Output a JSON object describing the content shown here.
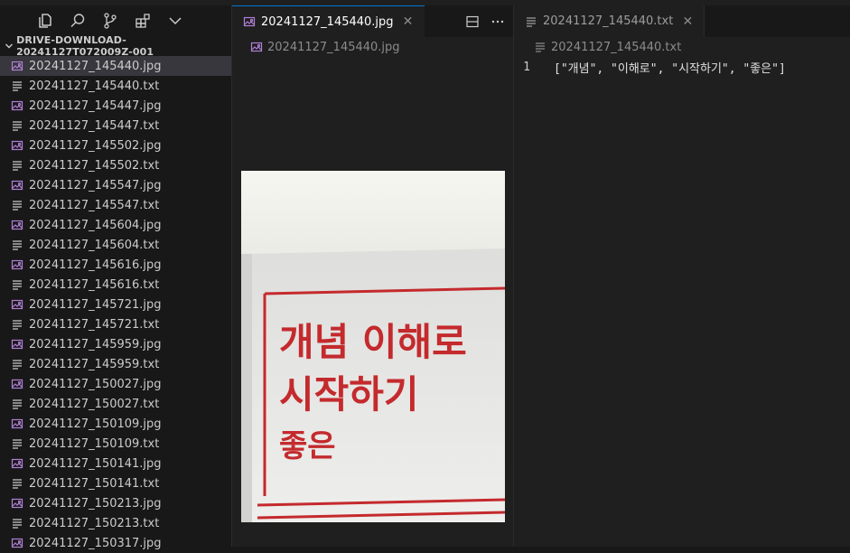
{
  "sidebar": {
    "activity_icons": [
      "explorer-icon",
      "search-icon",
      "source-control-icon",
      "extensions-icon",
      "more-views-chevron-icon"
    ],
    "folder_name": "DRIVE-DOWNLOAD-20241127T072009Z-001",
    "files": [
      {
        "name": "20241127_145440.jpg",
        "type": "image",
        "selected": true
      },
      {
        "name": "20241127_145440.txt",
        "type": "text"
      },
      {
        "name": "20241127_145447.jpg",
        "type": "image"
      },
      {
        "name": "20241127_145447.txt",
        "type": "text"
      },
      {
        "name": "20241127_145502.jpg",
        "type": "image"
      },
      {
        "name": "20241127_145502.txt",
        "type": "text"
      },
      {
        "name": "20241127_145547.jpg",
        "type": "image"
      },
      {
        "name": "20241127_145547.txt",
        "type": "text"
      },
      {
        "name": "20241127_145604.jpg",
        "type": "image"
      },
      {
        "name": "20241127_145604.txt",
        "type": "text"
      },
      {
        "name": "20241127_145616.jpg",
        "type": "image"
      },
      {
        "name": "20241127_145616.txt",
        "type": "text"
      },
      {
        "name": "20241127_145721.jpg",
        "type": "image"
      },
      {
        "name": "20241127_145721.txt",
        "type": "text"
      },
      {
        "name": "20241127_145959.jpg",
        "type": "image"
      },
      {
        "name": "20241127_145959.txt",
        "type": "text"
      },
      {
        "name": "20241127_150027.jpg",
        "type": "image"
      },
      {
        "name": "20241127_150027.txt",
        "type": "text"
      },
      {
        "name": "20241127_150109.jpg",
        "type": "image"
      },
      {
        "name": "20241127_150109.txt",
        "type": "text"
      },
      {
        "name": "20241127_150141.jpg",
        "type": "image"
      },
      {
        "name": "20241127_150141.txt",
        "type": "text"
      },
      {
        "name": "20241127_150213.jpg",
        "type": "image"
      },
      {
        "name": "20241127_150213.txt",
        "type": "text"
      },
      {
        "name": "20241127_150317.jpg",
        "type": "image"
      }
    ]
  },
  "editor_left": {
    "tab_label": "20241127_145440.jpg",
    "breadcrumb": "20241127_145440.jpg",
    "image_text": {
      "line1": "개념 이해로",
      "line2": "시작하기",
      "line3": "좋은"
    }
  },
  "editor_right": {
    "tab_label": "20241127_145440.txt",
    "breadcrumb": "20241127_145440.txt",
    "lines": [
      {
        "number": "1",
        "text": "[\"개념\", \"이해로\", \"시작하기\", \"좋은\"]"
      }
    ]
  },
  "colors": {
    "accent": "#0078d4",
    "image_icon": "#b180d7",
    "print_red": "#c42a2d"
  }
}
